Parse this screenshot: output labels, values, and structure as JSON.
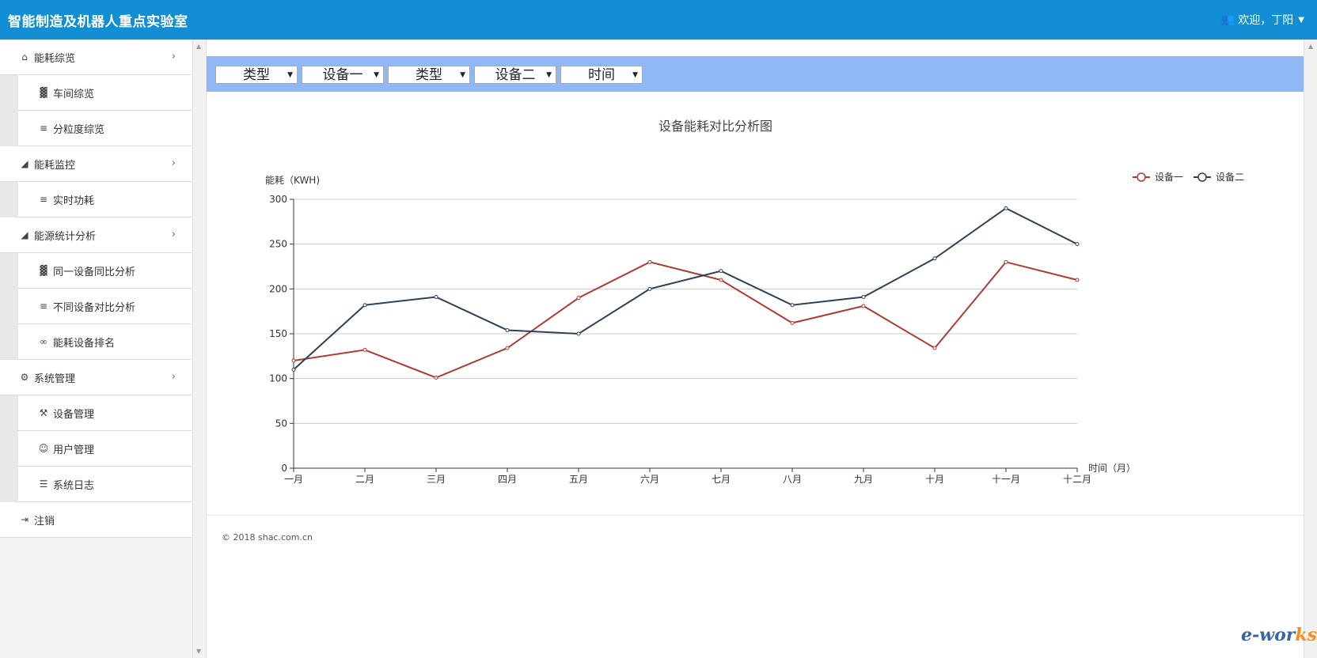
{
  "header": {
    "title": "智能制造及机器人重点实验室",
    "user_greeting": "欢迎，丁阳"
  },
  "sidebar": {
    "items": [
      {
        "label": "能耗综览",
        "icon": "home-icon",
        "level": "top",
        "expandable": true
      },
      {
        "label": "车间综览",
        "icon": "industry-icon",
        "level": "sub"
      },
      {
        "label": "分粒度综览",
        "icon": "list-icon",
        "level": "sub"
      },
      {
        "label": "能耗监控",
        "icon": "area-chart-icon",
        "level": "top",
        "expandable": true
      },
      {
        "label": "实时功耗",
        "icon": "list-icon",
        "level": "sub"
      },
      {
        "label": "能源统计分析",
        "icon": "area-chart-icon",
        "level": "top",
        "expandable": true
      },
      {
        "label": "同一设备同比分析",
        "icon": "industry-icon",
        "level": "sub"
      },
      {
        "label": "不同设备对比分析",
        "icon": "list-icon",
        "level": "sub"
      },
      {
        "label": "能耗设备排名",
        "icon": "link-icon",
        "level": "sub"
      },
      {
        "label": "系统管理",
        "icon": "gear-icon",
        "level": "top",
        "expandable": true
      },
      {
        "label": "设备管理",
        "icon": "wrench-icon",
        "level": "sub"
      },
      {
        "label": "用户管理",
        "icon": "users-icon",
        "level": "sub"
      },
      {
        "label": "系统日志",
        "icon": "list-ol-icon",
        "level": "sub"
      },
      {
        "label": "注销",
        "icon": "sign-out-icon",
        "level": "top",
        "expandable": false
      }
    ]
  },
  "filters": [
    {
      "name": "type-select-1",
      "value": "类型"
    },
    {
      "name": "device-select-1",
      "value": "设备一"
    },
    {
      "name": "type-select-2",
      "value": "类型"
    },
    {
      "name": "device-select-2",
      "value": "设备二"
    },
    {
      "name": "time-select",
      "value": "时间"
    }
  ],
  "chart_data": {
    "type": "line",
    "title": "设备能耗对比分析图",
    "ylabel": "能耗（KWH)",
    "xlabel": "时间（月）",
    "ylim": [
      0,
      300
    ],
    "yticks": [
      0,
      50,
      100,
      150,
      200,
      250,
      300
    ],
    "categories": [
      "一月",
      "二月",
      "三月",
      "四月",
      "五月",
      "六月",
      "七月",
      "八月",
      "九月",
      "十月",
      "十一月",
      "十二月"
    ],
    "legend_position": "top-right",
    "grid": true,
    "series": [
      {
        "name": "设备一",
        "color": "#b03a33",
        "values": [
          120,
          132,
          101,
          134,
          190,
          230,
          210,
          162,
          181,
          134,
          230,
          210
        ]
      },
      {
        "name": "设备二",
        "color": "#2e4157",
        "values": [
          110,
          182,
          191,
          154,
          150,
          200,
          220,
          182,
          191,
          234,
          290,
          250
        ]
      }
    ]
  },
  "footer": {
    "copyright": "© 2018 shac.com.cn"
  },
  "watermark": {
    "brand_main": "e-wor",
    "brand_tail": "ks"
  },
  "icons": {
    "user": "users-icon",
    "caret": "caret-down-icon",
    "chevron": "chevron-right-icon"
  },
  "colors": {
    "header_bg": "#128fd4",
    "filter_bar_bg": "#90b8f5"
  }
}
